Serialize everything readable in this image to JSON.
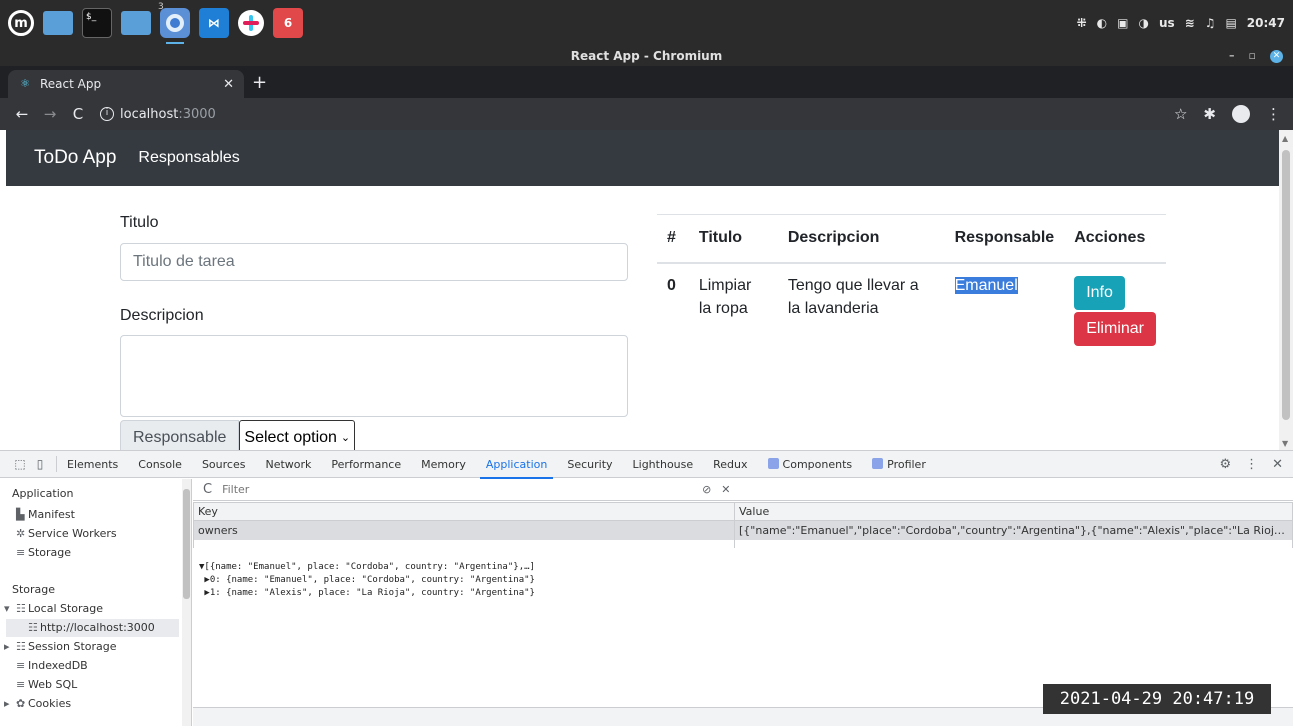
{
  "os": {
    "taskbar_apps": [
      "mint-menu-icon",
      "folder-icon",
      "terminal-icon",
      "files-icon",
      "chromium-icon",
      "vscode-icon",
      "slack-icon",
      "app-icon"
    ],
    "chromium_badge": "3",
    "terminal_glyph": "$_",
    "tray": {
      "keyboard_layout": "us",
      "time": "20:47"
    }
  },
  "window": {
    "title": "React App - Chromium"
  },
  "browser": {
    "tab_title": "React App",
    "url_host": "localhost",
    "url_port": ":3000"
  },
  "app": {
    "brand": "ToDo App",
    "nav_link": "Responsables",
    "form": {
      "titulo_label": "Titulo",
      "titulo_placeholder": "Titulo de tarea",
      "descripcion_label": "Descripcion",
      "responsable_label": "Responsable",
      "select_value": "Select option"
    },
    "table": {
      "headers": [
        "#",
        "Titulo",
        "Descripcion",
        "Responsable",
        "Acciones"
      ],
      "rows": [
        {
          "index": "0",
          "titulo": "Limpiar la ropa",
          "descripcion": "Tengo que llevar a la lavanderia",
          "responsable": "Emanuel",
          "btn_info": "Info",
          "btn_delete": "Eliminar"
        }
      ]
    }
  },
  "devtools": {
    "tabs": [
      "Elements",
      "Console",
      "Sources",
      "Network",
      "Performance",
      "Memory",
      "Application",
      "Security",
      "Lighthouse",
      "Redux",
      "Components",
      "Profiler"
    ],
    "active_tab": "Application",
    "sidebar": {
      "application_header": "Application",
      "manifest": "Manifest",
      "service_workers": "Service Workers",
      "storage_item": "Storage",
      "storage_header": "Storage",
      "local_storage": "Local Storage",
      "local_storage_origin": "http://localhost:3000",
      "session_storage": "Session Storage",
      "indexeddb": "IndexedDB",
      "websql": "Web SQL",
      "cookies": "Cookies"
    },
    "filter_placeholder": "Filter",
    "kv_headers": {
      "key": "Key",
      "value": "Value"
    },
    "entries": [
      {
        "key": "owners",
        "value": "[{\"name\":\"Emanuel\",\"place\":\"Cordoba\",\"country\":\"Argentina\"},{\"name\":\"Alexis\",\"place\":\"La Rioja\",\"cou..."
      }
    ],
    "preview": {
      "line0": "▼[{name: \"Emanuel\", place: \"Cordoba\", country: \"Argentina\"},…]",
      "line1": " ▶0: {name: \"Emanuel\", place: \"Cordoba\", country: \"Argentina\"}",
      "line2": " ▶1: {name: \"Alexis\", place: \"La Rioja\", country: \"Argentina\"}"
    }
  },
  "timestamp": "2021-04-29 20:47:19",
  "colors": {
    "navbar": "#343a40",
    "btn_info": "#17a2b8",
    "btn_danger": "#dc3545",
    "selection": "#3b7ddd",
    "devtools_accent": "#1a73e8"
  }
}
